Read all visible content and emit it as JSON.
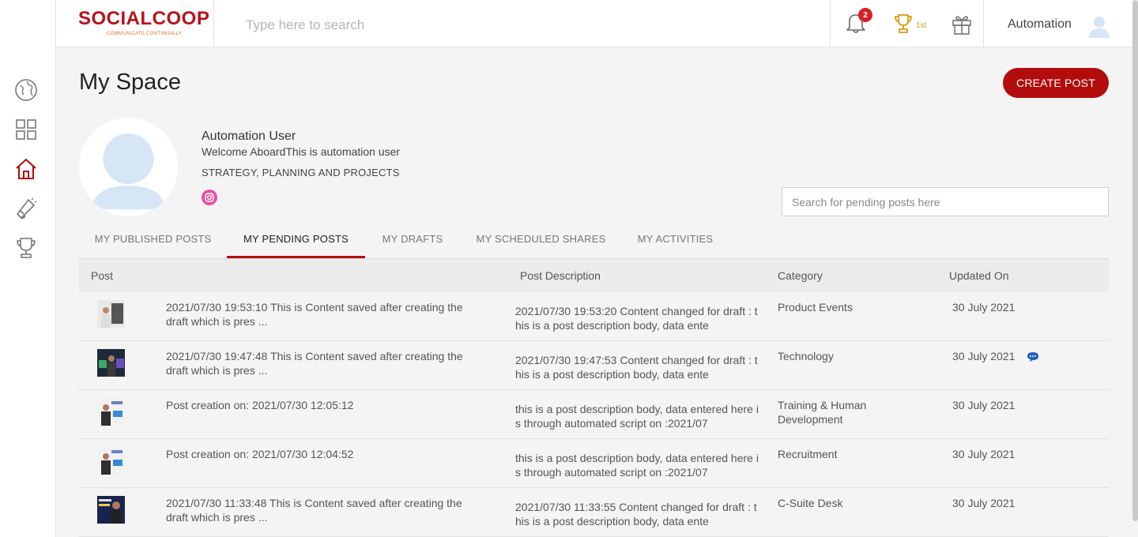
{
  "app": {
    "logo_text": "SOCIALCOOP",
    "logo_tagline": "COMMUNICATE CONTINUALLY",
    "brand_color": "#b8121a"
  },
  "header": {
    "search_placeholder": "Type here to search",
    "notification_count": "2",
    "leaderboard_rank": "1st",
    "user_name": "Automation"
  },
  "sidebar": {
    "items": [
      {
        "icon": "globe-icon"
      },
      {
        "icon": "dashboard-grid-icon"
      },
      {
        "icon": "home-icon",
        "active": true
      },
      {
        "icon": "megaphone-icon"
      },
      {
        "icon": "trophy-icon"
      }
    ]
  },
  "page": {
    "title": "My Space",
    "create_post_label": "CREATE POST"
  },
  "profile": {
    "name": "Automation User",
    "bio": "Welcome AboardThis is automation user",
    "department": "STRATEGY, PLANNING AND PROJECTS",
    "social_icon": "instagram-icon"
  },
  "pending_search": {
    "placeholder": "Search for pending posts here"
  },
  "tabs": [
    {
      "label": "MY PUBLISHED POSTS"
    },
    {
      "label": "MY PENDING POSTS",
      "active": true
    },
    {
      "label": "MY DRAFTS"
    },
    {
      "label": "MY SCHEDULED SHARES"
    },
    {
      "label": "MY ACTIVITIES"
    }
  ],
  "table": {
    "columns": [
      "Post",
      "Post Description",
      "Category",
      "Updated On"
    ],
    "rows": [
      {
        "post": "2021/07/30 19:53:10 This is Content saved after creating the draft which is pres ...",
        "description": "2021/07/30 19:53:20 Content changed for draft : this is a post description body, data ente",
        "category": "Product Events",
        "updated": "30 July 2021",
        "has_comment": false
      },
      {
        "post": "2021/07/30 19:47:48 This is Content saved after creating the draft which is pres ...",
        "description": "2021/07/30 19:47:53 Content changed for draft : this is a post description body, data ente",
        "category": "Technology",
        "updated": "30 July 2021",
        "has_comment": true
      },
      {
        "post": "Post creation on: 2021/07/30 12:05:12",
        "description": "this is a post description body, data entered here is through automated script on :2021/07",
        "category": "Training & Human Development",
        "updated": "30 July 2021",
        "has_comment": false
      },
      {
        "post": "Post creation on: 2021/07/30 12:04:52",
        "description": "this is a post description body, data entered here is through automated script on :2021/07",
        "category": "Recruitment",
        "updated": "30 July 2021",
        "has_comment": false
      },
      {
        "post": "2021/07/30 11:33:48 This is Content saved after creating the draft which is pres ...",
        "description": "2021/07/30 11:33:55 Content changed for draft : this is a post description body, data ente",
        "category": "C-Suite Desk",
        "updated": "30 July 2021",
        "has_comment": false
      }
    ]
  },
  "colors": {
    "accent": "#b30c0c",
    "badge": "#d42027",
    "trophy": "#d99a14",
    "chat": "#1f5fc4",
    "instagram": "#e8519e"
  }
}
